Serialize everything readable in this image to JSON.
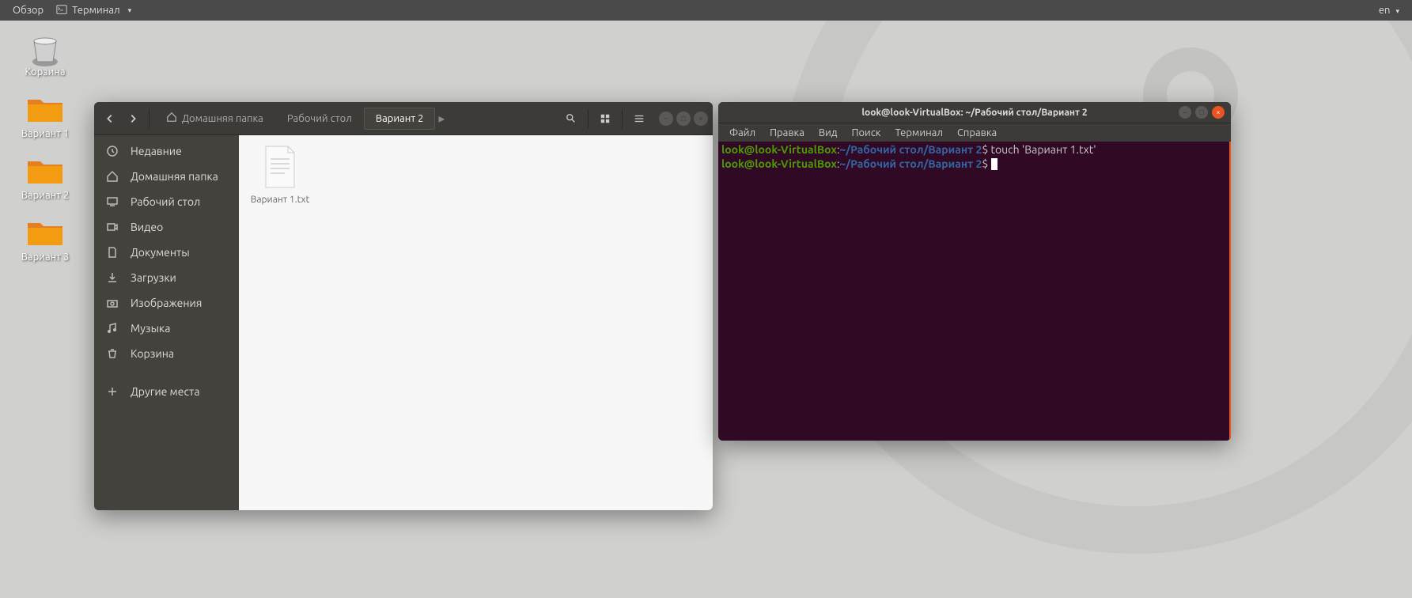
{
  "topbar": {
    "overview": "Обзор",
    "app_name": "Терминал",
    "lang": "en"
  },
  "desktop": {
    "trash": "Корзина",
    "folders": [
      "Вариант 1",
      "Вариант 2",
      "Вариант 3"
    ]
  },
  "nautilus": {
    "breadcrumb": {
      "home": "Домашняя папка",
      "segments": [
        "Рабочий стол",
        "Вариант 2"
      ]
    },
    "sidebar": {
      "recent": "Недавние",
      "home": "Домашняя папка",
      "desktop": "Рабочий стол",
      "videos": "Видео",
      "documents": "Документы",
      "downloads": "Загрузки",
      "pictures": "Изображения",
      "music": "Музыка",
      "trash": "Корзина",
      "other": "Другие места"
    },
    "files": [
      {
        "name": "Вариант 1.txt"
      }
    ]
  },
  "terminal": {
    "title": "look@look-VirtualBox: ~/Рабочий стол/Вариант 2",
    "menu": {
      "file": "Файл",
      "edit": "Правка",
      "view": "Вид",
      "search": "Поиск",
      "terminal": "Терминал",
      "help": "Справка"
    },
    "lines": [
      {
        "user": "look@look-VirtualBox",
        "colon": ":",
        "path": "~/Рабочий стол/Вариант 2",
        "prompt": "$",
        "cmd": " touch 'Вариант 1.txt'"
      },
      {
        "user": "look@look-VirtualBox",
        "colon": ":",
        "path": "~/Рабочий стол/Вариант 2",
        "prompt": "$",
        "cmd": "",
        "cursor": true
      }
    ]
  }
}
